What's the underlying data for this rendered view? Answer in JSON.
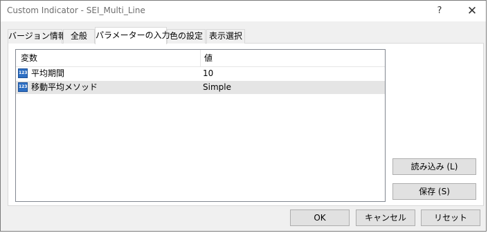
{
  "window": {
    "title": "Custom Indicator - SEI_Multi_Line",
    "help_glyph": "?",
    "close_glyph": "✕"
  },
  "tabs": [
    {
      "label": "バージョン情報"
    },
    {
      "label": "全般"
    },
    {
      "label": "パラメーターの入力"
    },
    {
      "label": "色の設定"
    },
    {
      "label": "表示選択"
    }
  ],
  "table": {
    "headers": {
      "variable": "変数",
      "value": "値"
    },
    "rows": [
      {
        "icon": "integer-type-icon",
        "icon_text": "123",
        "name": "平均期間",
        "value": "10"
      },
      {
        "icon": "integer-type-icon",
        "icon_text": "123",
        "name": "移動平均メソッド",
        "value": "Simple"
      }
    ]
  },
  "buttons": {
    "load": "読み込み (L)",
    "save": "保存 (S)",
    "ok": "OK",
    "cancel": "キャンセル",
    "reset": "リセット"
  }
}
